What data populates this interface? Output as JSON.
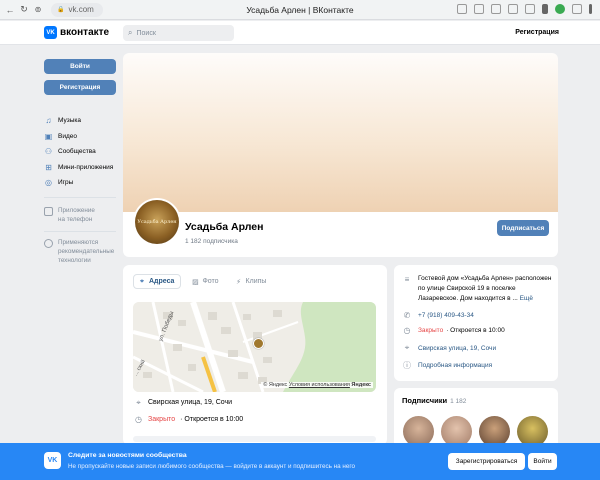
{
  "browser": {
    "url": "vk.com",
    "page_title": "Усадьба Арлен | ВКонтакте"
  },
  "header": {
    "logo_text": "вконтакте",
    "logo_mark": "VK",
    "search_placeholder": "Поиск",
    "register_label": "Регистрация"
  },
  "sidebar": {
    "login_button": "Войти",
    "register_button": "Регистрация",
    "items": [
      {
        "label": "Музыка",
        "icon": "music-icon"
      },
      {
        "label": "Видео",
        "icon": "video-icon"
      },
      {
        "label": "Сообщества",
        "icon": "communities-icon"
      },
      {
        "label": "Мини-приложения",
        "icon": "apps-icon"
      },
      {
        "label": "Игры",
        "icon": "games-icon"
      }
    ],
    "app_link": "Приложение\nна телефон",
    "recommend_link": "Применяются\nрекомендательные\nтехнологии"
  },
  "group": {
    "name": "Усадьба Арлен",
    "subscribers": "1 182 подписчика",
    "subscribe_button": "Подписаться",
    "avatar_caption": "Усадьба Арлен"
  },
  "tabs": {
    "address": "Адреса",
    "photo": "Фото",
    "clips": "Клипы"
  },
  "map": {
    "street1": "ул. Победы",
    "street2": "... ский",
    "attribution_prefix": "© Яндекс",
    "attribution_link": "Условия использования",
    "attribution_brand": "Яндекс"
  },
  "location": {
    "address": "Свирская улица, 19, Сочи",
    "status": "Закрыто",
    "opens": "· Откроется в 10:00"
  },
  "info": {
    "description": "Гостевой дом «Усадьба Арлен» расположен по улице Свирской 19 в поселке Лазаревское. Дом находится в ...",
    "more": "Ещё",
    "phone": "+7 (918) 409-43-34",
    "status": "Закрыто",
    "opens": "· Откроется в 10:00",
    "address": "Свирская улица, 19, Сочи",
    "details": "Подробная информация"
  },
  "subscribers": {
    "title": "Подписчики",
    "count": "1 182"
  },
  "banner": {
    "logo": "VK",
    "title": "Следите за новостями сообщества",
    "subtitle": "Не пропускайте новые записи любимого сообщества — войдите в аккаунт и подпишитесь на него",
    "register_button": "Зарегистрироваться",
    "login_button": "Войти"
  }
}
